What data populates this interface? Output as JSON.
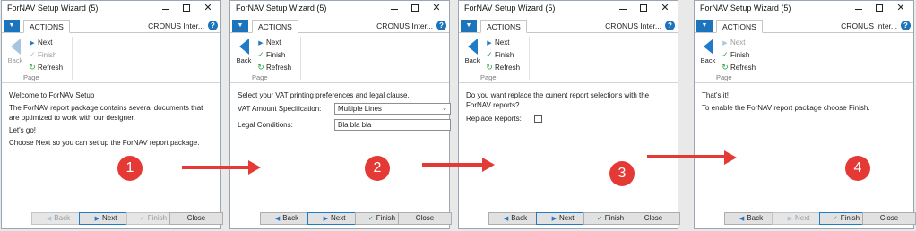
{
  "window_title": "ForNAV Setup Wizard (5)",
  "tab_actions": "ACTIONS",
  "company": "CRONUS Inter...",
  "help_glyph": "?",
  "ribbon": {
    "back": "Back",
    "next": "Next",
    "finish": "Finish",
    "refresh": "Refresh",
    "group": "Page"
  },
  "buttons": {
    "back": "Back",
    "next": "Next",
    "finish": "Finish",
    "close": "Close"
  },
  "steps": [
    {
      "number": "1",
      "texts": [
        "Welcome to ForNAV Setup",
        "The ForNAV report package contains several documents that are optimized to work with our designer.",
        "Let's go!",
        "Choose Next so you can set up the ForNAV report package."
      ],
      "back_enabled": false,
      "next_enabled": true,
      "finish_enabled": false,
      "default_button": "next"
    },
    {
      "number": "2",
      "texts": [
        "Select your VAT printing preferences and legal clause."
      ],
      "fields": {
        "vat_label": "VAT Amount Specification:",
        "vat_value": "Multiple Lines",
        "legal_label": "Legal Conditions:",
        "legal_value": "Bla bla bla"
      },
      "back_enabled": true,
      "next_enabled": true,
      "finish_enabled": true,
      "default_button": "next"
    },
    {
      "number": "3",
      "texts": [
        "Do you want replace the current report selections with the ForNAV reports?"
      ],
      "fields": {
        "replace_label": "Replace Reports:",
        "replace_checked": false
      },
      "back_enabled": true,
      "next_enabled": true,
      "finish_enabled": true,
      "default_button": "next"
    },
    {
      "number": "4",
      "texts": [
        "That's it!",
        "To enable the ForNAV report package choose Finish."
      ],
      "back_enabled": true,
      "next_enabled": false,
      "finish_enabled": true,
      "default_button": "finish"
    }
  ],
  "colors": {
    "accent_blue": "#1f7ac7",
    "app_menu_blue": "#1c75bc",
    "step_red": "#e53935",
    "finish_green": "#2e9e3e"
  },
  "icons": {
    "back": "back-arrow-icon",
    "next": "next-arrow-icon",
    "finish": "checkmark-icon",
    "refresh": "refresh-icon",
    "help": "help-icon"
  }
}
